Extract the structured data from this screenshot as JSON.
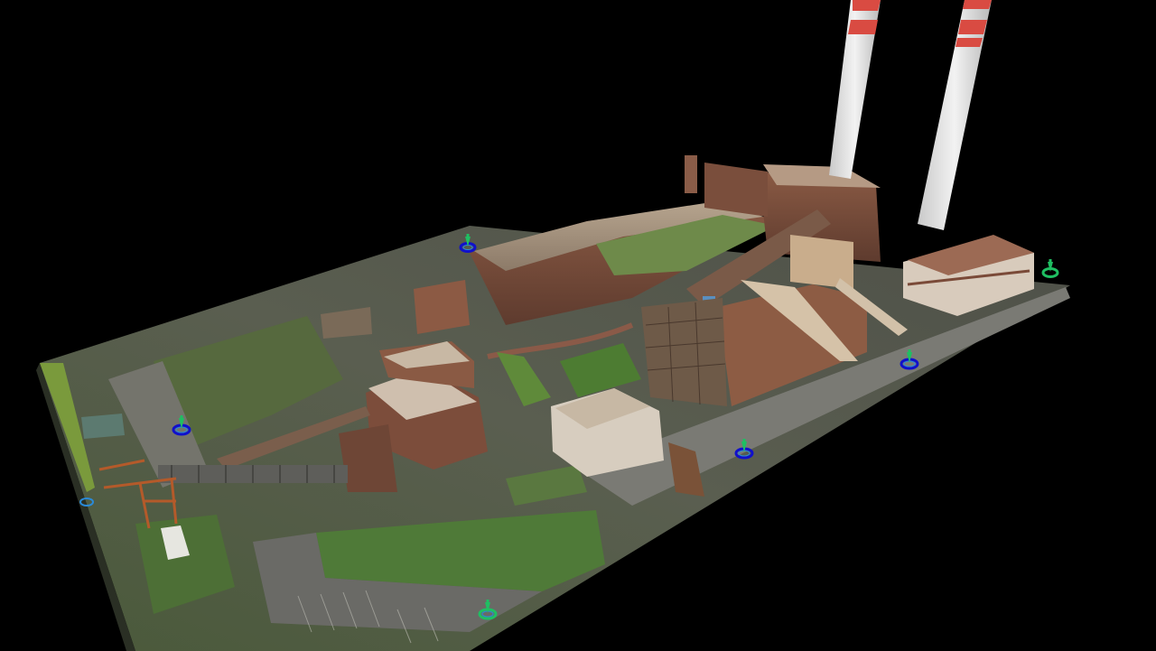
{
  "viewer": {
    "background_color": "#000000",
    "scene": "point-cloud-industrial-site",
    "marker_icon": "camera-station-pin-icon",
    "marker_colors": {
      "pin": "#1fbf62",
      "ring_outer": "#1010cc",
      "ring_inner": "#2a8ad8"
    },
    "marker_count": 7
  }
}
